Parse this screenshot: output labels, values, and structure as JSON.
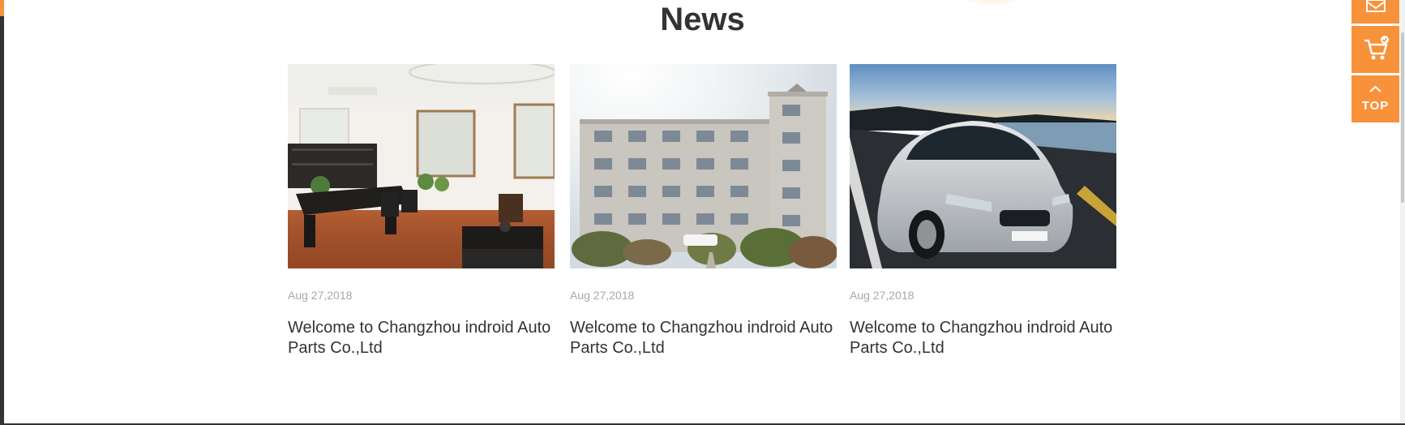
{
  "section": {
    "title": "News"
  },
  "news": [
    {
      "date": "Aug 27,2018",
      "headline": "Welcome to Changzhou indroid Auto Parts Co.,Ltd",
      "image": "office-interior-photo"
    },
    {
      "date": "Aug 27,2018",
      "headline": "Welcome to Changzhou indroid Auto Parts Co.,Ltd",
      "image": "factory-building-photo"
    },
    {
      "date": "Aug 27,2018",
      "headline": "Welcome to Changzhou indroid Auto Parts Co.,Ltd",
      "image": "silver-car-photo"
    }
  ],
  "sidebar": {
    "mail_icon": "envelope-icon",
    "cart_icon": "cart-icon",
    "top_label": "TOP"
  },
  "colors": {
    "accent": "#f7913a",
    "title": "#333333",
    "date": "#a8a8a8"
  }
}
